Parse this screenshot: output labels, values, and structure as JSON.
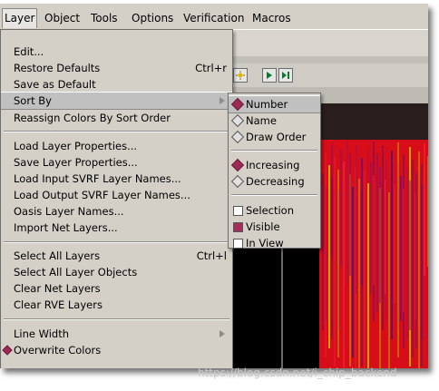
{
  "menubar": {
    "items": [
      {
        "label": "Layer",
        "active": true
      },
      {
        "label": "Object"
      },
      {
        "label": "Tools"
      },
      {
        "label": "Options"
      },
      {
        "label": "Verification"
      },
      {
        "label": "Macros"
      }
    ]
  },
  "layer_menu": {
    "items": [
      {
        "label": "Edit...",
        "shortcut": ""
      },
      {
        "label": "Restore Defaults",
        "shortcut": "Ctrl+r"
      },
      {
        "label": "Save as Default",
        "shortcut": ""
      },
      {
        "label": "Sort By",
        "submenu": true,
        "highlighted": true
      },
      {
        "label": "Reassign Colors By Sort Order",
        "shortcut": ""
      },
      {
        "label": "Load Layer Properties...",
        "shortcut": ""
      },
      {
        "label": "Save Layer Properties...",
        "shortcut": ""
      },
      {
        "label": "Load Input SVRF Layer Names...",
        "shortcut": ""
      },
      {
        "label": "Load Output SVRF Layer Names...",
        "shortcut": ""
      },
      {
        "label": "Oasis Layer Names...",
        "shortcut": ""
      },
      {
        "label": "Import Net Layers...",
        "shortcut": ""
      },
      {
        "label": "Select All Layers",
        "shortcut": "Ctrl+l"
      },
      {
        "label": "Select All Layer Objects",
        "shortcut": ""
      },
      {
        "label": "Clear Net Layers",
        "shortcut": ""
      },
      {
        "label": "Clear RVE Layers",
        "shortcut": ""
      },
      {
        "label": "Line Width",
        "submenu": true
      },
      {
        "label": "Overwrite Colors",
        "shortcut": ""
      }
    ]
  },
  "sort_submenu": {
    "sort_keys": [
      {
        "label": "Number",
        "selected": true
      },
      {
        "label": "Name",
        "selected": false
      },
      {
        "label": "Draw Order",
        "selected": false
      }
    ],
    "direction": [
      {
        "label": "Increasing",
        "selected": true
      },
      {
        "label": "Decreasing",
        "selected": false
      }
    ],
    "filters": [
      {
        "label": "Selection",
        "checked": false
      },
      {
        "label": "Visible",
        "checked": true
      },
      {
        "label": "In View",
        "checked": false
      }
    ]
  },
  "watermark": "https://blog.csdn.net/i_chip_backend",
  "colors": {
    "menu_bg": "#d4d0c8",
    "canvas_red": "#d80d1a",
    "radio_on": "#9b2a55",
    "check_on": "#a52d5a"
  }
}
